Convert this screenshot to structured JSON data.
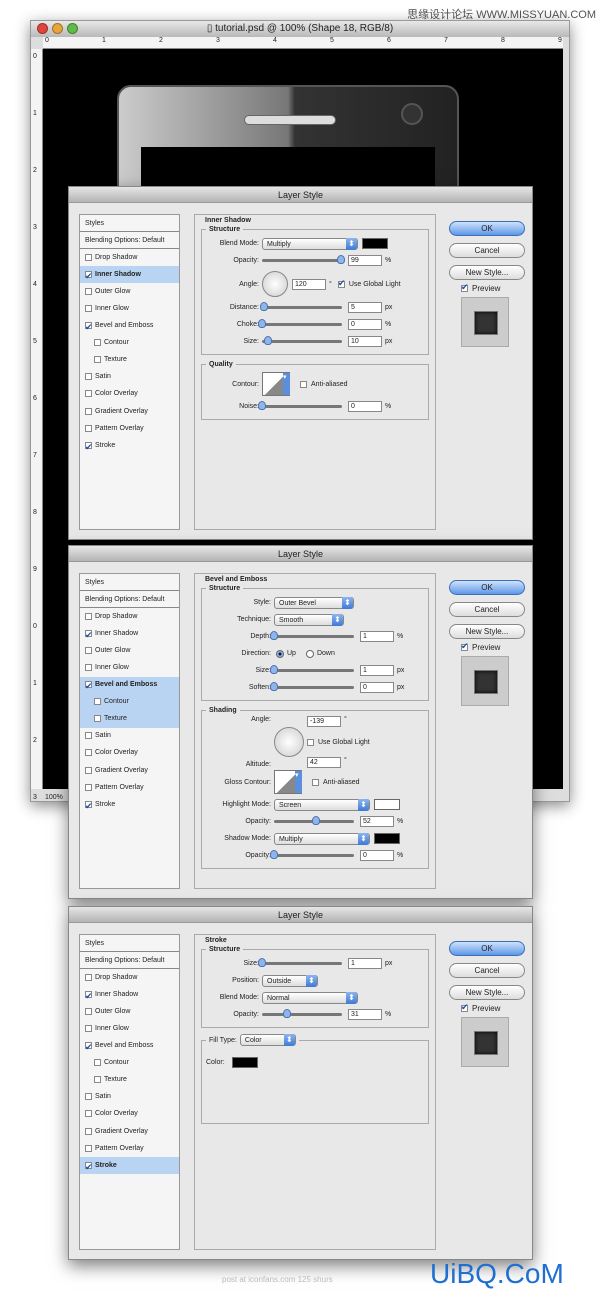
{
  "watermark_top": "思缘设计论坛 WWW.MISSYUAN.COM",
  "window": {
    "title": "tutorial.psd @ 100% (Shape 18, RGB/8)",
    "zoom_level": "100%",
    "ruler_h": [
      "0",
      "1",
      "2",
      "3",
      "4",
      "5",
      "6",
      "7",
      "8",
      "9"
    ],
    "ruler_v": [
      "0",
      "1",
      "2",
      "3",
      "4",
      "5",
      "6",
      "7",
      "8",
      "9",
      "0",
      "1",
      "2",
      "3"
    ]
  },
  "colors": {
    "accent": "#5d98e8",
    "selected_row": "#b9d3f3",
    "canvas": "#000000"
  },
  "style_items": [
    "Styles",
    "Blending Options: Default",
    "Drop Shadow",
    "Inner Shadow",
    "Outer Glow",
    "Inner Glow",
    "Bevel and Emboss",
    "Contour",
    "Texture",
    "Satin",
    "Color Overlay",
    "Gradient Overlay",
    "Pattern Overlay",
    "Stroke"
  ],
  "buttons": {
    "ok": "OK",
    "cancel": "Cancel",
    "new_style": "New Style...",
    "preview": "Preview",
    "preview_checked": true
  },
  "dialogs": [
    {
      "title": "Layer Style",
      "checked": [
        "Inner Shadow",
        "Bevel and Emboss",
        "Stroke"
      ],
      "selected": [
        "Inner Shadow"
      ],
      "section": "Inner Shadow",
      "label_width": 56,
      "groups": [
        {
          "legend": "Structure",
          "rows": [
            {
              "type": "select",
              "label": "Blend Mode:",
              "value": "Multiply",
              "width": 96,
              "swatch": "#000000"
            },
            {
              "type": "slider",
              "label": "Opacity:",
              "value": "99",
              "unit": "%",
              "position": 0.99
            },
            {
              "type": "angle",
              "label": "Angle:",
              "value": "120",
              "unit": "°",
              "check_label": "Use Global Light",
              "checked": true
            },
            {
              "type": "slider",
              "label": "Distance:",
              "value": "5",
              "unit": "px",
              "position": 0.02
            },
            {
              "type": "slider",
              "label": "Choke:",
              "value": "0",
              "unit": "%",
              "position": 0
            },
            {
              "type": "slider",
              "label": "Size:",
              "value": "10",
              "unit": "px",
              "position": 0.08
            }
          ]
        },
        {
          "legend": "Quality",
          "rows": [
            {
              "type": "contour",
              "label": "Contour:",
              "check_label": "Anti-aliased",
              "checked": false
            },
            {
              "type": "slider",
              "label": "Noise:",
              "value": "0",
              "unit": "%",
              "position": 0
            }
          ]
        }
      ]
    },
    {
      "title": "Layer Style",
      "checked": [
        "Bevel and Emboss",
        "Inner Shadow",
        "Stroke"
      ],
      "selected": [
        "Bevel and Emboss",
        "Contour",
        "Texture"
      ],
      "section": "Bevel and Emboss",
      "label_width": 68,
      "groups": [
        {
          "legend": "Structure",
          "rows": [
            {
              "type": "select",
              "label": "Style:",
              "value": "Outer Bevel",
              "width": 80
            },
            {
              "type": "select",
              "label": "Technique:",
              "value": "Smooth",
              "width": 70
            },
            {
              "type": "slider",
              "label": "Depth:",
              "value": "1",
              "unit": "%",
              "position": 0
            },
            {
              "type": "radio",
              "label": "Direction:",
              "options": [
                "Up",
                "Down"
              ],
              "selected": "Up"
            },
            {
              "type": "slider",
              "label": "Size:",
              "value": "1",
              "unit": "px",
              "position": 0
            },
            {
              "type": "slider",
              "label": "Soften:",
              "value": "0",
              "unit": "px",
              "position": 0
            }
          ]
        },
        {
          "legend": "Shading",
          "rows": [
            {
              "type": "shading_angle",
              "label": "Angle:",
              "value": "-139",
              "unit": "°",
              "check_label": "Use Global Light",
              "checked": false,
              "altitude_label": "Altitude:",
              "altitude": "42"
            },
            {
              "type": "contour",
              "label": "Gloss Contour:",
              "check_label": "Anti-aliased",
              "checked": false
            },
            {
              "type": "select",
              "label": "Highlight Mode:",
              "value": "Screen",
              "width": 96,
              "swatch": "#ffffff"
            },
            {
              "type": "slider",
              "label": "Opacity:",
              "value": "52",
              "unit": "%",
              "position": 0.52
            },
            {
              "type": "select",
              "label": "Shadow Mode:",
              "value": "Multiply",
              "width": 96,
              "swatch": "#000000"
            },
            {
              "type": "slider",
              "label": "Opacity:",
              "value": "0",
              "unit": "%",
              "position": 0
            }
          ]
        }
      ]
    },
    {
      "title": "Layer Style",
      "checked": [
        "Inner Shadow",
        "Bevel and Emboss",
        "Stroke"
      ],
      "selected": [
        "Stroke"
      ],
      "section": "Stroke",
      "label_width": 56,
      "groups": [
        {
          "legend": "Structure",
          "rows": [
            {
              "type": "slider",
              "label": "Size:",
              "value": "1",
              "unit": "px",
              "position": 0
            },
            {
              "type": "select",
              "label": "Position:",
              "value": "Outside",
              "width": 56
            },
            {
              "type": "select",
              "label": "Blend Mode:",
              "value": "Normal",
              "width": 96
            },
            {
              "type": "slider",
              "label": "Opacity:",
              "value": "31",
              "unit": "%",
              "position": 0.31
            }
          ]
        },
        {
          "legend_select": {
            "label": "Fill Type:",
            "value": "Color"
          },
          "rows": [
            {
              "type": "color",
              "label": "Color:",
              "swatch": "#000000"
            }
          ]
        }
      ]
    }
  ],
  "footer": {
    "credit": "post at iconfans.com 125 shurs",
    "watermark": "UiBQ.CoM"
  }
}
